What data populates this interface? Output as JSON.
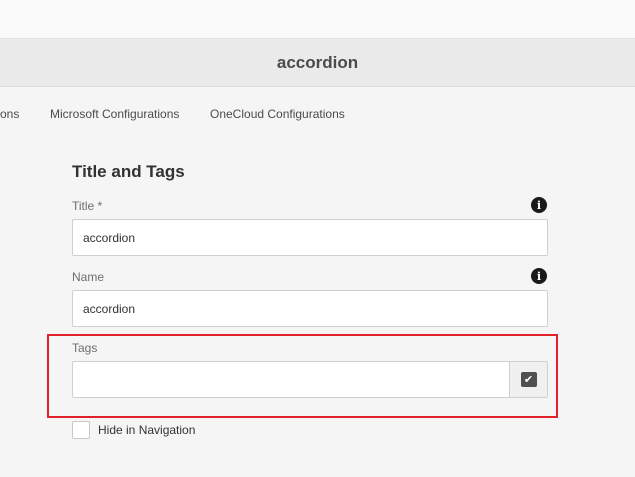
{
  "header": {
    "page_title": "accordion"
  },
  "tabs": [
    {
      "label": "ons"
    },
    {
      "label": "Microsoft Configurations"
    },
    {
      "label": "OneCloud Configurations"
    }
  ],
  "form": {
    "section_title": "Title and Tags",
    "title_field": {
      "label": "Title *",
      "value": "accordion",
      "info_icon": "info-icon"
    },
    "name_field": {
      "label": "Name",
      "value": "accordion",
      "info_icon": "info-icon"
    },
    "tags_field": {
      "label": "Tags",
      "value": "",
      "button_icon": "checkmark-icon"
    },
    "hide_in_navigation": {
      "label": "Hide in Navigation",
      "checked": false
    }
  },
  "colors": {
    "highlight": "#e0202a",
    "background": "#f5f5f5"
  }
}
